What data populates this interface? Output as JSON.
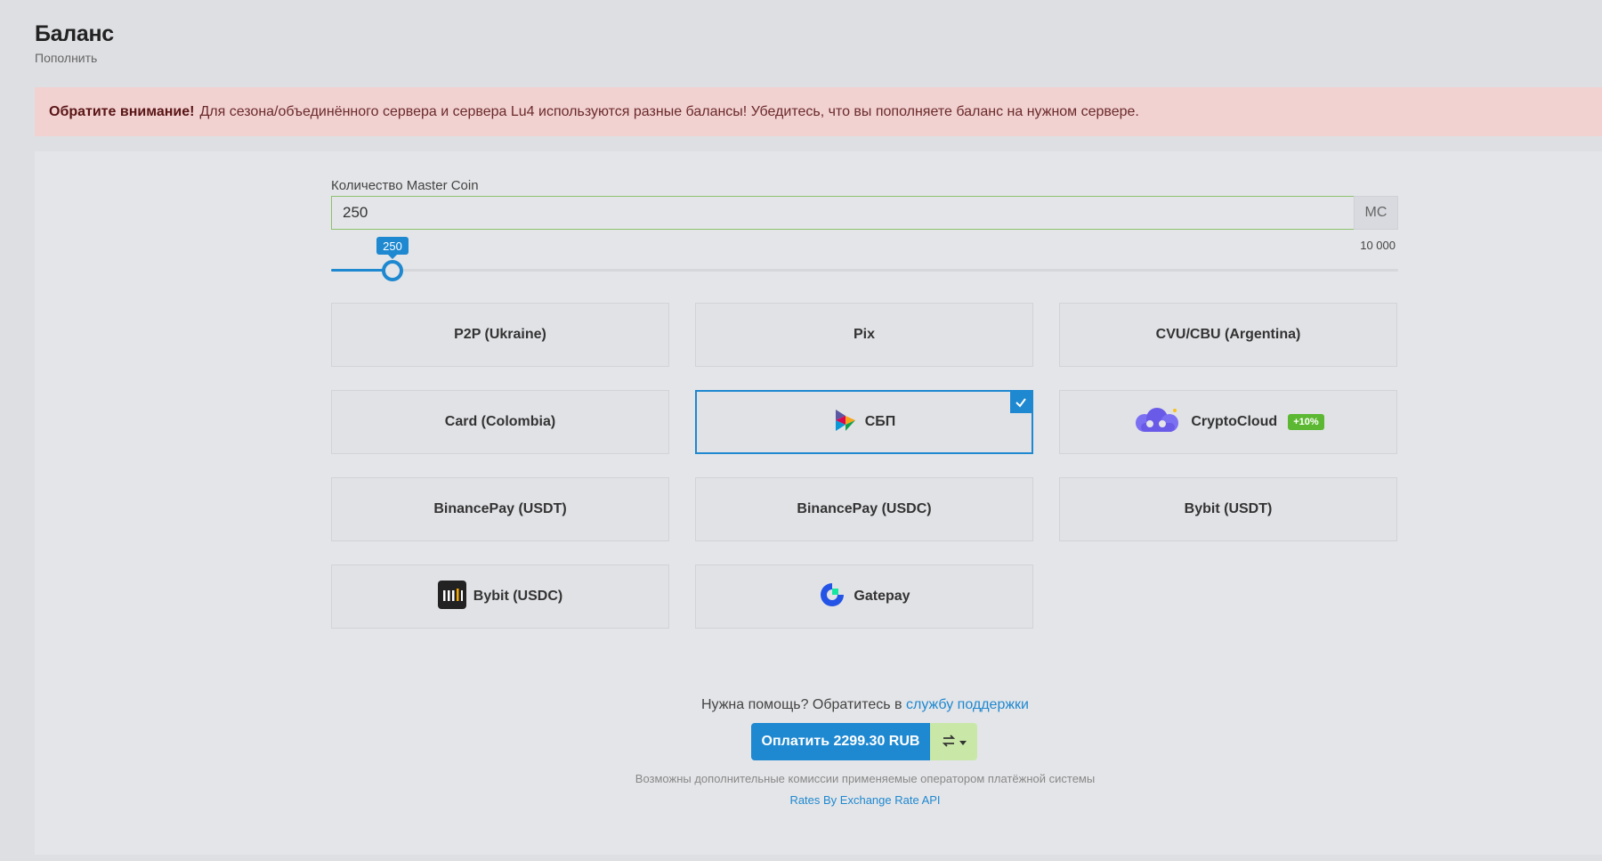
{
  "page": {
    "title": "Баланс",
    "subtitle": "Пополнить"
  },
  "alert": {
    "strong": "Обратите внимание!",
    "text": "Для сезона/объединённого сервера и сервера Lu4 используются разные балансы! Убедитесь, что вы пополняете баланс на нужном сервере."
  },
  "amount": {
    "label": "Количество Master Coin",
    "value": "250",
    "unit": "MC"
  },
  "slider": {
    "value": 250,
    "value_label": "250",
    "min": 0,
    "max": 10000,
    "max_label": "10 000"
  },
  "methods": [
    {
      "label": "P2P (Ukraine)",
      "icon": "",
      "selected": false
    },
    {
      "label": "Pix",
      "icon": "",
      "selected": false
    },
    {
      "label": "CVU/CBU (Argentina)",
      "icon": "",
      "selected": false
    },
    {
      "label": "Card (Colombia)",
      "icon": "",
      "selected": false
    },
    {
      "label": "СБП",
      "icon": "sbp-logo-icon",
      "selected": true
    },
    {
      "label": "CryptoCloud",
      "icon": "cryptocloud-logo-icon",
      "selected": false,
      "badge": "+10%"
    },
    {
      "label": "BinancePay (USDT)",
      "icon": "",
      "selected": false
    },
    {
      "label": "BinancePay (USDC)",
      "icon": "",
      "selected": false
    },
    {
      "label": "Bybit (USDT)",
      "icon": "",
      "selected": false
    },
    {
      "label": "Bybit (USDC)",
      "icon": "bybit-logo-icon",
      "selected": false
    },
    {
      "label": "Gatepay",
      "icon": "gatepay-logo-icon",
      "selected": false
    }
  ],
  "help": {
    "text": "Нужна помощь? Обратитесь в",
    "link": "службу поддержки"
  },
  "pay": {
    "button": "Оплатить 2299.30 RUB",
    "toggle_icon": "swap-arrows-icon"
  },
  "footer": {
    "fees_note": "Возможны дополнительные комиссии применяемые оператором платёжной системы",
    "rates_link": "Rates By Exchange Rate API"
  },
  "colors": {
    "accent": "#1e88d0",
    "success": "#5cb832",
    "alert_bg": "#f2d1d1"
  }
}
